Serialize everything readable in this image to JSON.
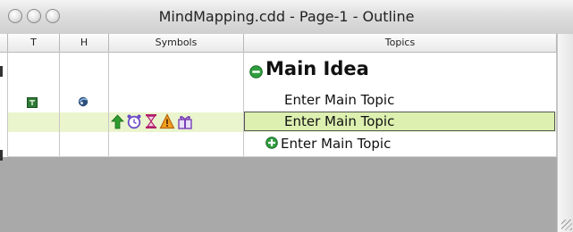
{
  "window": {
    "title": "MindMapping.cdd - Page-1 - Outline"
  },
  "columns": {
    "t": "T",
    "h": "H",
    "symbols": "Symbols",
    "topics": "Topics"
  },
  "topics": {
    "main": "Main Idea",
    "items": [
      "Enter Main Topic",
      "Enter Main Topic",
      "Enter Main Topic"
    ]
  },
  "colors": {
    "selection_row": "#eaf5cd",
    "selected_cell": "#ddf0b0",
    "empty_area": "#a9a9a9"
  },
  "icons": {
    "t_column": "task-icon",
    "h_column": "hyperlink-icon",
    "symbols": [
      "up-arrow-icon",
      "alarm-clock-icon",
      "hourglass-icon",
      "warning-icon",
      "gift-icon"
    ],
    "main_toggle": "collapse-icon",
    "topic3_toggle": "expand-icon"
  }
}
